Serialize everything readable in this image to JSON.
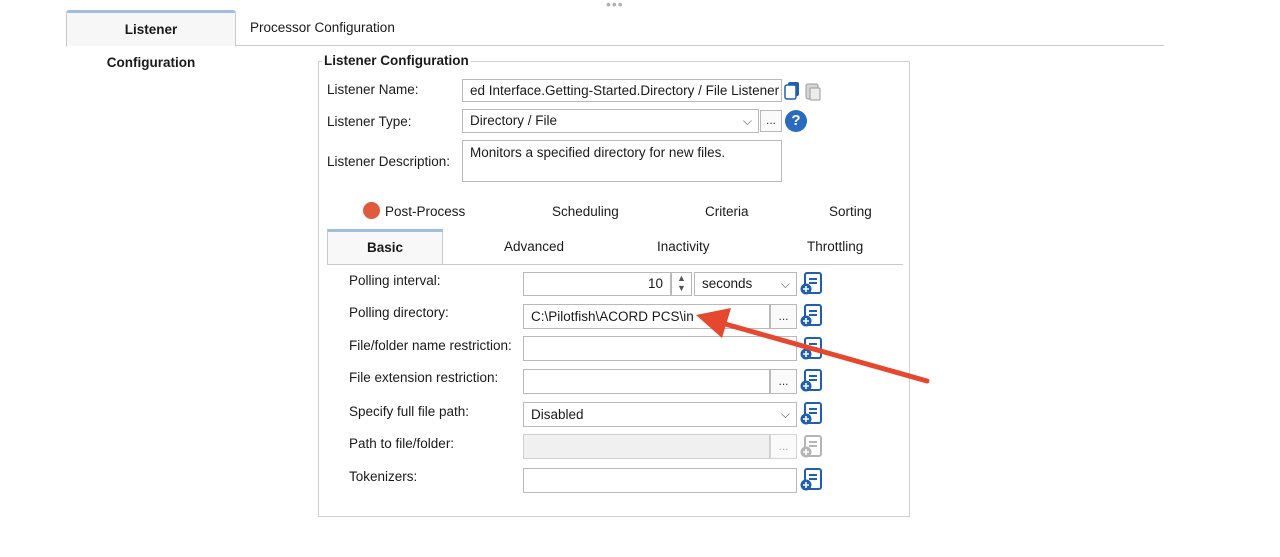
{
  "tabs": {
    "listener_config": "Listener Configuration",
    "processor_config": "Processor Configuration"
  },
  "group": {
    "legend": "Listener Configuration",
    "listener_name_label": "Listener Name:",
    "listener_name_value": "ed Interface.Getting-Started.Directory / File Listener",
    "listener_type_label": "Listener Type:",
    "listener_type_value": "Directory / File",
    "listener_type_browse": "...",
    "listener_desc_label": "Listener Description:",
    "listener_desc_value": "Monitors a specified directory for new files."
  },
  "subtabs_row1": [
    "Post-Process",
    "Scheduling",
    "Criteria",
    "Sorting"
  ],
  "subtabs_row2": [
    "Basic",
    "Advanced",
    "Inactivity",
    "Throttling"
  ],
  "basic": {
    "polling_interval_label": "Polling interval:",
    "polling_interval_value": "10",
    "polling_interval_unit": "seconds",
    "polling_directory_label": "Polling directory:",
    "polling_directory_value": "C:\\Pilotfish\\ACORD PCS\\in",
    "name_restriction_label": "File/folder name restriction:",
    "name_restriction_value": "",
    "ext_restriction_label": "File extension restriction:",
    "ext_restriction_value": "",
    "full_path_label": "Specify full file path:",
    "full_path_value": "Disabled",
    "path_label": "Path to file/folder:",
    "path_value": "",
    "tokenizers_label": "Tokenizers:",
    "tokenizers_value": "",
    "browse": "..."
  },
  "colors": {
    "accent_tab": "#9fbfdc",
    "help_blue": "#2a6bbf",
    "status_red": "#e05a3d",
    "arrow_red": "#e5482e"
  },
  "icons": [
    "copy-icon",
    "paste-icon",
    "help-icon",
    "add-variable-icon",
    "chevron-down-icon",
    "spinner-icon",
    "arrow-annotation-icon"
  ]
}
